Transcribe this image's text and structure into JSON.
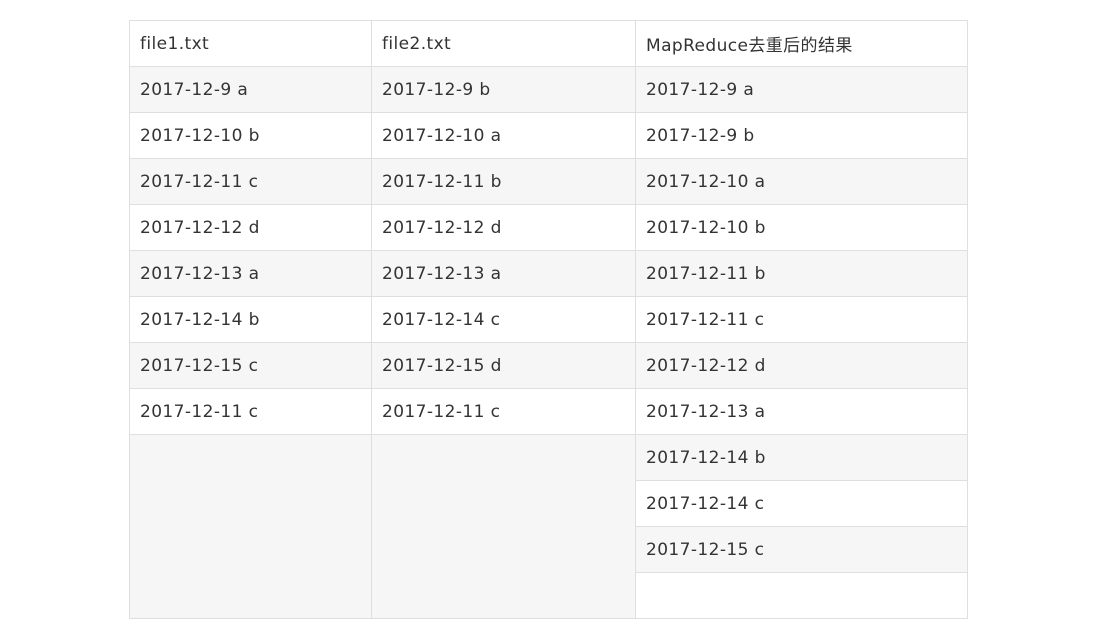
{
  "table": {
    "headers": [
      "file1.txt",
      "file2.txt",
      "MapReduce去重后的结果"
    ],
    "file1_rows": [
      "2017-12-9 a",
      "2017-12-10 b",
      "2017-12-11 c",
      "2017-12-12 d",
      "2017-12-13 a",
      "2017-12-14 b",
      "2017-12-15 c",
      "2017-12-11 c"
    ],
    "file2_rows": [
      "2017-12-9 b",
      "2017-12-10 a",
      "2017-12-11 b",
      "2017-12-12 d",
      "2017-12-13 a",
      "2017-12-14 c",
      "2017-12-15 d",
      "2017-12-11 c"
    ],
    "result_rows": [
      "2017-12-9 a",
      "2017-12-9 b",
      "2017-12-10 a",
      "2017-12-10 b",
      "2017-12-11 b",
      "2017-12-11 c",
      "2017-12-12 d",
      "2017-12-13 a",
      "2017-12-14 b",
      "2017-12-14 c",
      "2017-12-15 c"
    ]
  },
  "colors": {
    "border": "#dfdfdf",
    "stripe": "#f6f6f6",
    "text": "#333333"
  }
}
